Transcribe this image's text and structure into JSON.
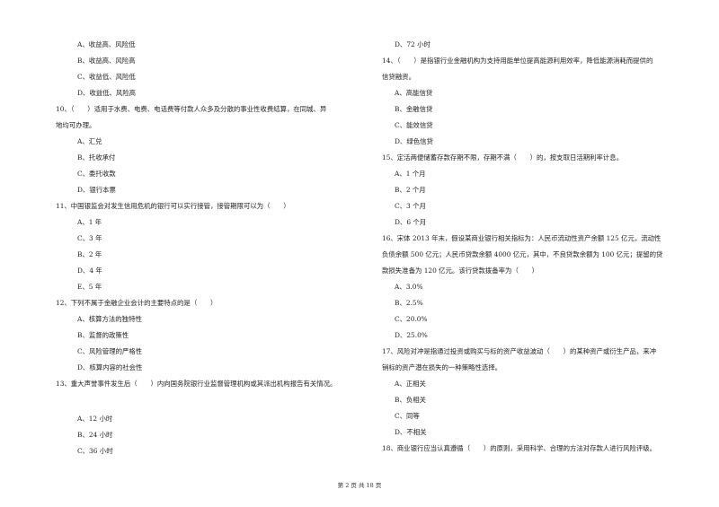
{
  "page": {
    "footer": "第 2 页 共 18 页"
  },
  "left": {
    "q9_options": [
      "A、收益高、风险低",
      "B、收益高、风险高",
      "C、收益低、风险低",
      "D、收益低、风险高"
    ],
    "q10": {
      "line1": "10、（　　）适用于水费、电费、电话费等付款人众多及分散的事业性收费结算，在同城、异",
      "line2": "地均可办理。",
      "options": [
        "A、汇兑",
        "B、托收承付",
        "C、委托收款",
        "D、银行本票"
      ]
    },
    "q11": {
      "line1": "11、中国银监会对发生信用危机的银行可以实行接管，接管期限可以为（　　）",
      "options": [
        "A、1 年",
        "C、3 年",
        "B、2 年",
        "D、4 年",
        "E、5 年"
      ]
    },
    "q12": {
      "line1": "12、下列不属于金融企业会计的主要特点的是（　　）",
      "options": [
        "A、核算方法的独特性",
        "B、监督的政策性",
        "C、风险管理的严格性",
        "D、核算内容的社会性"
      ]
    },
    "q13": {
      "line1": "13、重大声誉事件发生后（　　）内向国务院银行业监督管理机构或其派出机构报告有关情况。",
      "options": [
        "A、12 小时",
        "B、24 小时",
        "C、36 小时"
      ]
    }
  },
  "right": {
    "q13_cont_option": "D、72 小时",
    "q14": {
      "line1": "14、（　　）是指银行业金融机构为支持用能单位提高能源利用效率，降低能源消耗而提供的",
      "line2": "信贷融资。",
      "options": [
        "A、高能信贷",
        "B、金融信贷",
        "C、能效信贷",
        "D、绿色信贷"
      ]
    },
    "q15": {
      "line1": "15、定活两便储蓄存款存期不限，存期不满（　　）的，按支取日活期利率计息。",
      "options": [
        "A、1 个月",
        "B、2 个月",
        "C、3 个月",
        "D、6 个月"
      ]
    },
    "q16": {
      "line1": "16、宋体 2013 年末，假设某商业银行相关指标为：人民币流动性资产余额 125 亿元，流动性",
      "line2": "负债余额 500 亿元；人民币贷款余额 4000 亿元，其中，不良贷款余额为 100 亿元；提留的贷",
      "line3": "款损失准备为 120 亿元。该行贷款拨备率为（　　）",
      "options": [
        "A、3.0%",
        "B、2.5%",
        "C、20.0%",
        "D、25.0%"
      ]
    },
    "q17": {
      "line1": "17、风险对冲是指通过投资或购买与标的资产收益波动（　　）的某种资产或衍生产品，来冲",
      "line2": "销标的资产潜在损失的一种策略性选择。",
      "options": [
        "A、正相关",
        "B、负相关",
        "C、同等",
        "D、不相关"
      ]
    },
    "q18": {
      "line1": "18、商业银行应当认真遵循（　　）的原则，采用科学、合理的方法对存款人进行风险评级。"
    }
  }
}
